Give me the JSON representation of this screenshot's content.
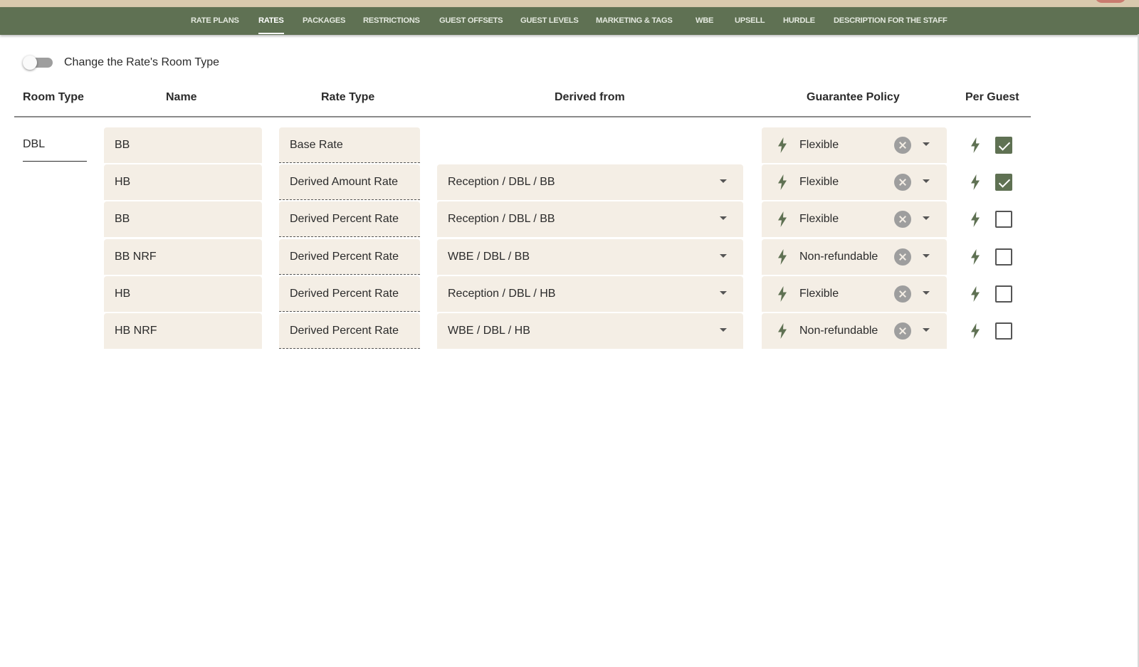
{
  "nav": {
    "tabs": [
      {
        "label": "RATE PLANS",
        "active": false
      },
      {
        "label": "RATES",
        "active": true
      },
      {
        "label": "PACKAGES",
        "active": false
      },
      {
        "label": "RESTRICTIONS",
        "active": false
      },
      {
        "label": "GUEST OFFSETS",
        "active": false
      },
      {
        "label": "GUEST LEVELS",
        "active": false
      },
      {
        "label": "MARKETING & TAGS",
        "active": false
      },
      {
        "label": "WBE",
        "active": false
      },
      {
        "label": "UPSELL",
        "active": false
      },
      {
        "label": "HURDLE",
        "active": false
      },
      {
        "label": "DESCRIPTION FOR THE STAFF",
        "active": false
      }
    ]
  },
  "toggle": {
    "label": "Change the Rate's Room Type",
    "on": false
  },
  "table": {
    "headers": {
      "room_type": "Room Type",
      "name": "Name",
      "rate_type": "Rate Type",
      "derived_from": "Derived from",
      "guarantee_policy": "Guarantee Policy",
      "per_guest": "Per Guest"
    },
    "room_type": "DBL",
    "rows": [
      {
        "name": "BB",
        "rate_type": "Base Rate",
        "derived_from": "",
        "guarantee_policy": "Flexible",
        "per_guest": true
      },
      {
        "name": "HB",
        "rate_type": "Derived Amount Rate",
        "derived_from": "Reception / DBL / BB",
        "guarantee_policy": "Flexible",
        "per_guest": true
      },
      {
        "name": "BB",
        "rate_type": "Derived Percent Rate",
        "derived_from": "Reception / DBL / BB",
        "guarantee_policy": "Flexible",
        "per_guest": false
      },
      {
        "name": "BB NRF",
        "rate_type": "Derived Percent Rate",
        "derived_from": "WBE / DBL / BB",
        "guarantee_policy": "Non-refundable",
        "per_guest": false
      },
      {
        "name": "HB",
        "rate_type": "Derived Percent Rate",
        "derived_from": "Reception / DBL / HB",
        "guarantee_policy": "Flexible",
        "per_guest": false
      },
      {
        "name": "HB NRF",
        "rate_type": "Derived Percent Rate",
        "derived_from": "WBE / DBL / HB",
        "guarantee_policy": "Non-refundable",
        "per_guest": false
      }
    ]
  },
  "icons": {
    "policy_icon": "bolt-icon",
    "per_guest_icon": "bolt-icon",
    "clear_icon": "clear-icon",
    "dropdown_icon": "chevron-down-icon"
  },
  "colors": {
    "nav_background": "#5f7153",
    "top_strip": "#d9c9ad",
    "field_background": "#f4eee5",
    "checkbox_checked": "#5f7153",
    "icon_color": "#5f7153"
  }
}
